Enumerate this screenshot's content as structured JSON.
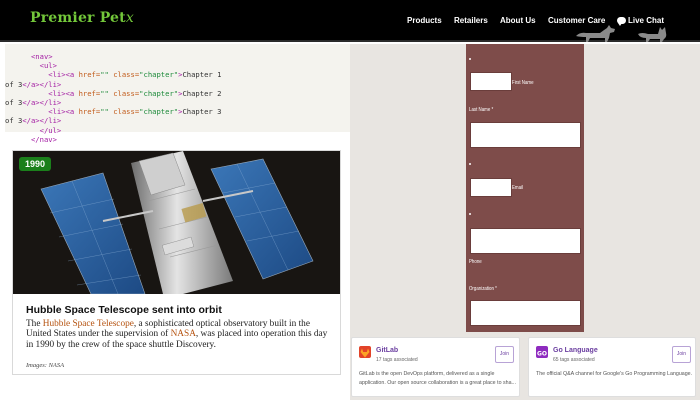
{
  "header": {
    "logo": "Premier Pet",
    "logo_swash": "x",
    "nav": [
      "Products",
      "Retailers",
      "About Us",
      "Customer Care",
      "Live Chat"
    ]
  },
  "code": {
    "lines": [
      [
        [
          "tag",
          "      <nav>"
        ]
      ],
      [
        [
          "tag",
          "        <ul>"
        ]
      ],
      [
        [
          "tag",
          "          <li><a "
        ],
        [
          "attr",
          "href="
        ],
        [
          "str",
          "\"\""
        ],
        [
          "attr",
          " class="
        ],
        [
          "str",
          "\"chapter\""
        ],
        [
          "tag",
          ">"
        ],
        [
          "txt",
          "Chapter 1"
        ]
      ],
      [
        [
          "txt",
          "of 3"
        ],
        [
          "tag",
          "</a></li>"
        ]
      ],
      [
        [
          "tag",
          "          <li><a "
        ],
        [
          "attr",
          "href="
        ],
        [
          "str",
          "\"\""
        ],
        [
          "attr",
          " class="
        ],
        [
          "str",
          "\"chapter\""
        ],
        [
          "tag",
          ">"
        ],
        [
          "txt",
          "Chapter 2"
        ]
      ],
      [
        [
          "txt",
          "of 3"
        ],
        [
          "tag",
          "</a></li>"
        ]
      ],
      [
        [
          "tag",
          "          <li><a "
        ],
        [
          "attr",
          "href="
        ],
        [
          "str",
          "\"\""
        ],
        [
          "attr",
          " class="
        ],
        [
          "str",
          "\"chapter\""
        ],
        [
          "tag",
          ">"
        ],
        [
          "txt",
          "Chapter 3"
        ]
      ],
      [
        [
          "txt",
          "of 3"
        ],
        [
          "tag",
          "</a></li>"
        ]
      ],
      [
        [
          "tag",
          "        </ul>"
        ]
      ],
      [
        [
          "tag",
          "      </nav>"
        ]
      ]
    ]
  },
  "card": {
    "badge": "1990",
    "title": "Hubble Space Telescope sent into orbit",
    "body": [
      [
        "text",
        "The "
      ],
      [
        "link",
        "Hubble Space Telescope"
      ],
      [
        "text",
        ", a sophisticated optical observatory built in the United States under the supervision of "
      ],
      [
        "link",
        "NASA"
      ],
      [
        "text",
        ", was placed into operation this day in 1990 by the crew of the space shuttle Discovery."
      ]
    ],
    "credit": "Images: NASA"
  },
  "form": {
    "first_name_label": "First Name",
    "last_name_label": "Last Name *",
    "email_label": "Email",
    "phone_label": "Phone",
    "organization_label": "Organization *"
  },
  "communities": [
    {
      "name": "GitLab",
      "tags": "17 tags associated",
      "join": "Join",
      "description": "GitLab is the open DevOps platform, delivered as a single\napplication. Our open source collaboration is a great place to sha...",
      "icon_color": "#e24329"
    },
    {
      "name": "Go Language",
      "tags": "65 tags associated",
      "join": "Join",
      "description": "The official Q&A channel for Google's Go Programming Language.",
      "icon_color": "#8e2bbf"
    }
  ],
  "colors": {
    "brand_green": "#73c73a",
    "form_panel": "#7e4c4a",
    "community_purple": "#6b3fa0"
  }
}
